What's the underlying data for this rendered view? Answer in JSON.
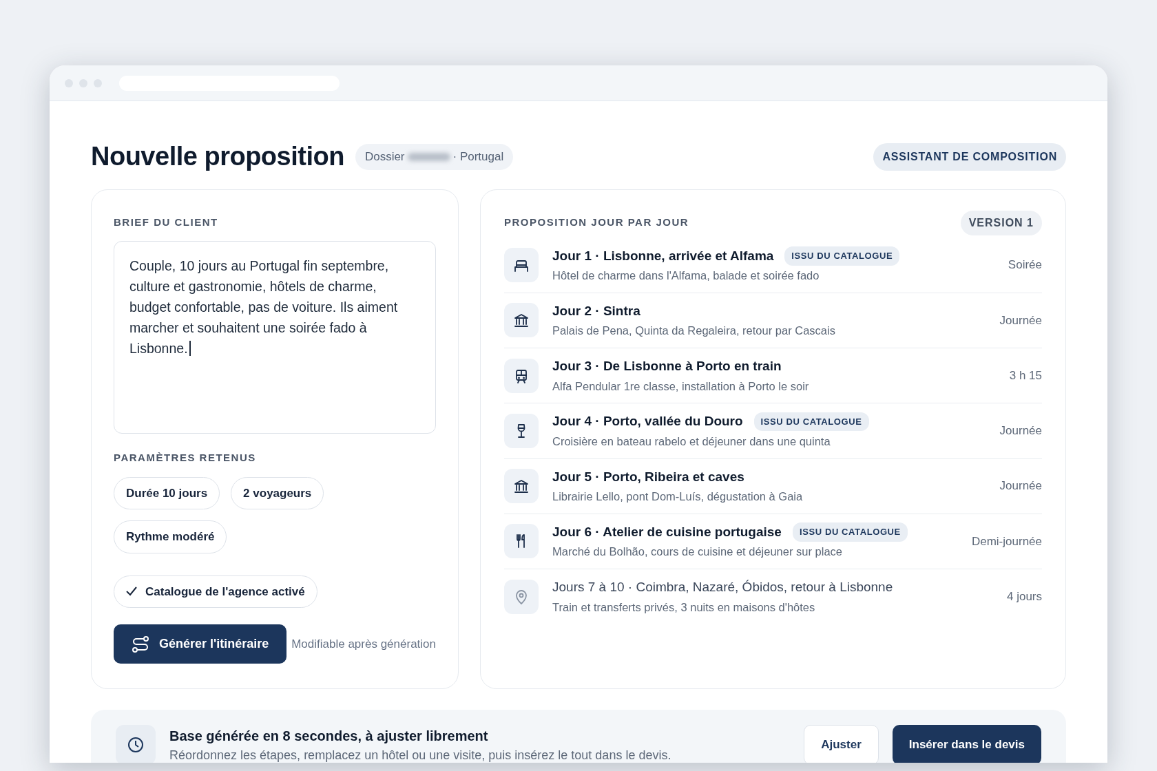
{
  "page": {
    "title": "Nouvelle proposition",
    "dossier_label": "Dossier",
    "dossier_suffix": "· Portugal",
    "assistant_badge": "ASSISTANT DE COMPOSITION"
  },
  "brief": {
    "heading": "BRIEF DU CLIENT",
    "text": "Couple, 10 jours au Portugal fin septembre, culture et gastronomie, hôtels de charme, budget confortable, pas de voiture. Ils aiment marcher et souhaitent une soirée fado à Lisbonne.",
    "params_heading": "PARAMÈTRES RETENUS",
    "params": [
      {
        "label": "Durée 10 jours",
        "checked": false
      },
      {
        "label": "2 voyageurs",
        "checked": false
      },
      {
        "label": "Rythme modéré",
        "checked": false
      },
      {
        "label": "Catalogue de l'agence activé",
        "checked": true
      }
    ],
    "generate_button": "Générer l'itinéraire",
    "note": "Modifiable après génération"
  },
  "proposal": {
    "heading": "PROPOSITION JOUR PAR JOUR",
    "version": "VERSION 1",
    "days": [
      {
        "kind": "hotel",
        "title": "Jour 1 · Lisbonne, arrivée et Alfama",
        "tag": "ISSU DU CATALOGUE",
        "subtitle": "Hôtel de charme dans l'Alfama, balade et soirée fado",
        "duration": "Soirée",
        "muted": false
      },
      {
        "kind": "visit",
        "title": "Jour 2 · Sintra",
        "subtitle": "Palais de Pena, Quinta da Regaleira, retour par Cascais",
        "duration": "Journée",
        "muted": false
      },
      {
        "kind": "train",
        "title": "Jour 3 · De Lisbonne à Porto en train",
        "subtitle": "Alfa Pendular 1re classe, installation à Porto le soir",
        "duration": "3 h 15",
        "muted": false
      },
      {
        "kind": "wine",
        "title": "Jour 4 · Porto, vallée du Douro",
        "tag": "ISSU DU CATALOGUE",
        "subtitle": "Croisière en bateau rabelo et déjeuner dans une quinta",
        "duration": "Journée",
        "muted": false
      },
      {
        "kind": "visit",
        "title": "Jour 5 · Porto, Ribeira et caves",
        "subtitle": "Librairie Lello, pont Dom-Luís, dégustation à Gaia",
        "duration": "Journée",
        "muted": false
      },
      {
        "kind": "food",
        "title": "Jour 6 · Atelier de cuisine portugaise",
        "tag": "ISSU DU CATALOGUE",
        "subtitle": "Marché du Bolhão, cours de cuisine et déjeuner sur place",
        "duration": "Demi-journée",
        "muted": false
      },
      {
        "kind": "place",
        "title": "Jours 7 à 10 · Coimbra, Nazaré, Óbidos, retour à Lisbonne",
        "subtitle": "Train et transferts privés, 3 nuits en maisons d'hôtes",
        "duration": "4 jours",
        "muted": true
      }
    ]
  },
  "footer": {
    "title": "Base générée en 8 secondes, à ajuster librement",
    "text": "Réordonnez les étapes, remplacez un hôtel ou une visite, puis insérez le tout dans le devis.",
    "adjust_button": "Ajuster",
    "insert_button": "Insérer dans le devis"
  }
}
